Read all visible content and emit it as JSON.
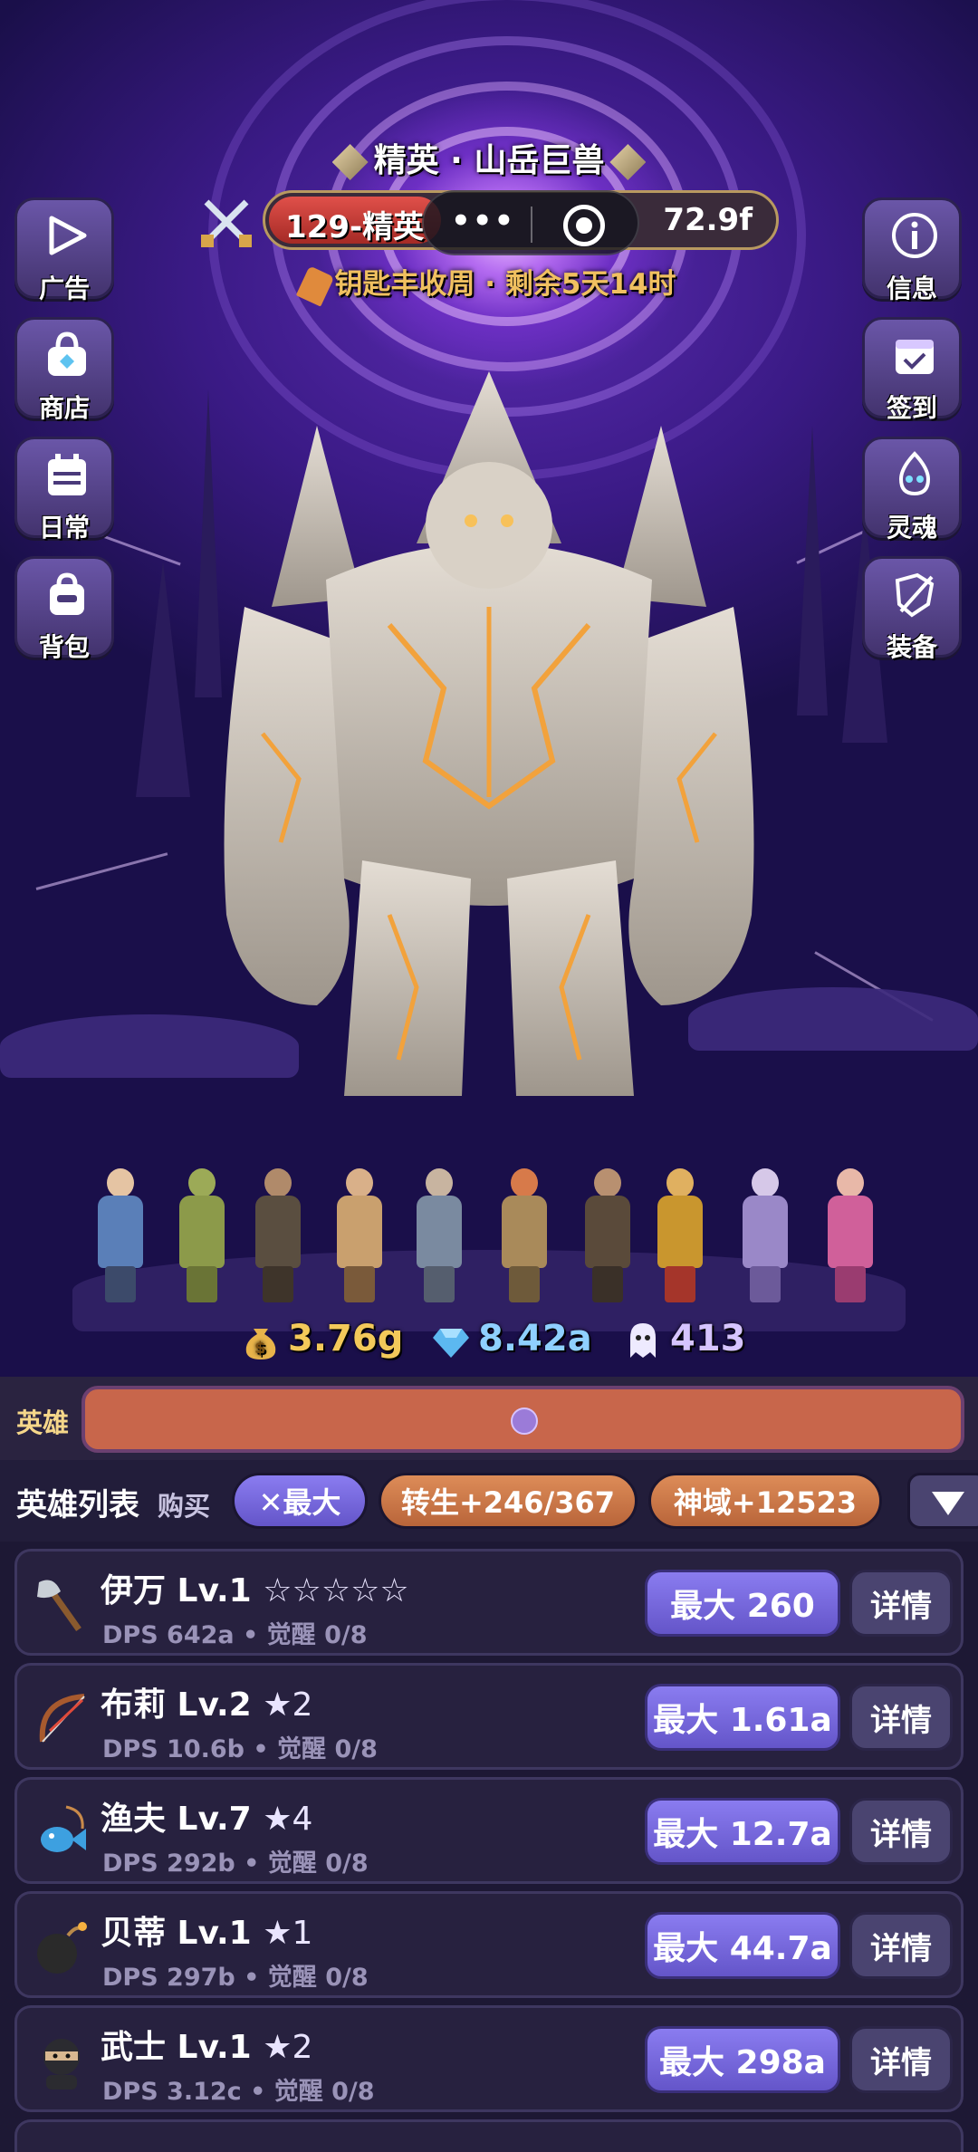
{
  "boss": {
    "title": "精英 · 山岳巨兽",
    "level_tag": "129-精英",
    "timer": "72.9f",
    "event_text": "钥匙丰收周 · 剩余5天14时"
  },
  "capsule": {
    "more_label": "•••"
  },
  "left_buttons": [
    {
      "label": "广告",
      "icon": "play-icon"
    },
    {
      "label": "商店",
      "icon": "shop-bag-icon"
    },
    {
      "label": "日常",
      "icon": "calendar-icon"
    },
    {
      "label": "背包",
      "icon": "backpack-icon"
    }
  ],
  "right_buttons": [
    {
      "label": "信息",
      "icon": "info-icon"
    },
    {
      "label": "签到",
      "icon": "checkin-calendar-icon"
    },
    {
      "label": "灵魂",
      "icon": "soul-icon"
    },
    {
      "label": "装备",
      "icon": "equipment-sword-shield-icon"
    }
  ],
  "resources": {
    "gold": "3.76g",
    "gems": "8.42a",
    "souls": "413"
  },
  "hero_bar": {
    "label": "英雄"
  },
  "list_header": {
    "title": "英雄列表",
    "buy_label": "购买",
    "max_pill": "✕最大",
    "rebirth_pill": "转生+246/367",
    "domain_pill": "神域+12523"
  },
  "heroes": [
    {
      "name": "伊万 Lv.1",
      "stars": "☆☆☆☆☆",
      "dps": "DPS 642a • 觉醒 0/8",
      "max": "最大 260",
      "detail": "详情",
      "icon": "axe-icon"
    },
    {
      "name": "布莉 Lv.2",
      "stars": "★2",
      "dps": "DPS 10.6b • 觉醒 0/8",
      "max": "最大 1.61a",
      "detail": "详情",
      "icon": "bow-icon"
    },
    {
      "name": "渔夫 Lv.7",
      "stars": "★4",
      "dps": "DPS 292b • 觉醒 0/8",
      "max": "最大 12.7a",
      "detail": "详情",
      "icon": "fish-icon"
    },
    {
      "name": "贝蒂 Lv.1",
      "stars": "★1",
      "dps": "DPS 297b • 觉醒 0/8",
      "max": "最大 44.7a",
      "detail": "详情",
      "icon": "bomb-icon"
    },
    {
      "name": "武士 Lv.1",
      "stars": "★2",
      "dps": "DPS 3.12c • 觉醒 0/8",
      "max": "最大 298a",
      "detail": "详情",
      "icon": "ninja-icon"
    }
  ],
  "colors": {
    "accent_purple": "#7566dc",
    "accent_orange": "#cb7848",
    "hp_red": "#c63a34",
    "event_gold": "#f0c060"
  }
}
